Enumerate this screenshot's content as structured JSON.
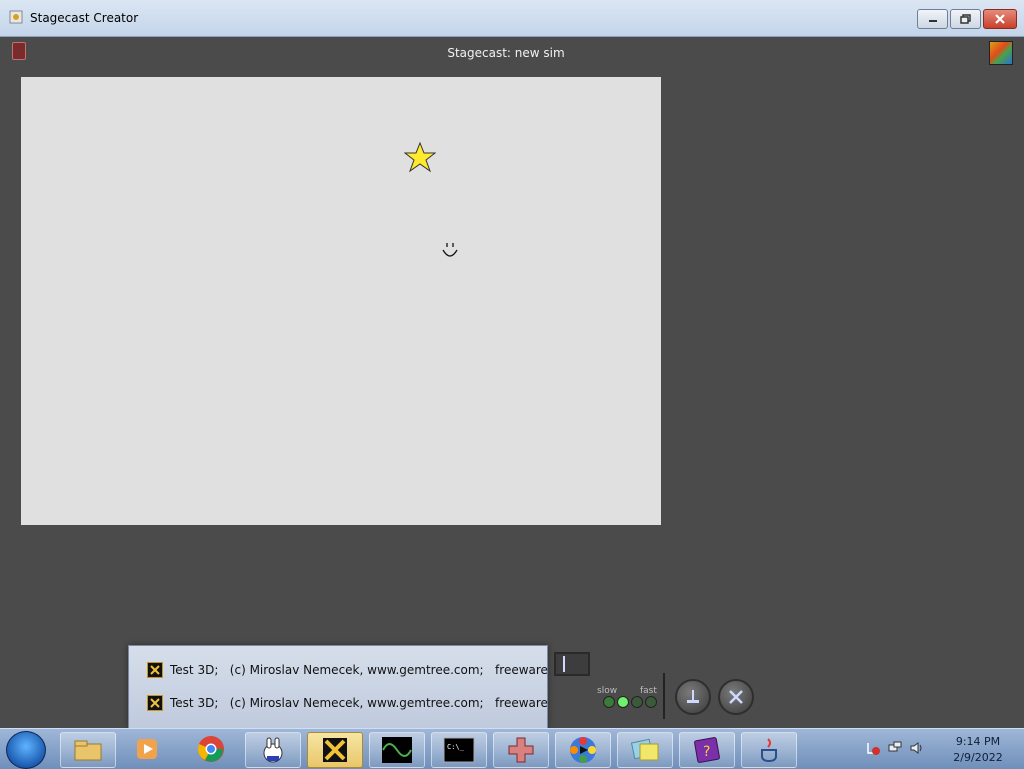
{
  "window": {
    "title": "Stagecast Creator",
    "minimize_glyph": "–",
    "maximize_glyph": "❐",
    "close_glyph": "✕"
  },
  "stagecast": {
    "title": "Stagecast: new sim",
    "book_icon": "rule-book-icon",
    "palette_icon": "color-palette-icon",
    "stage_background": "#e0e0e0",
    "speed_slow": "slow",
    "speed_fast": "fast",
    "speed_level": 2,
    "speed_levels_total": 4
  },
  "popup": {
    "items": [
      {
        "label": "Test 3D;   (c) Miroslav Nemecek, www.gemtree.com;   freeware"
      },
      {
        "label": "Test 3D;   (c) Miroslav Nemecek, www.gemtree.com;   freeware"
      }
    ]
  },
  "taskbar": {
    "items": [
      "start-icon",
      "explorer-icon",
      "media-player-icon",
      "chrome-icon",
      "rabbit-app-icon",
      "peter-x-icon",
      "oscilloscope-icon",
      "cmd-icon",
      "cross-puzzle-icon",
      "flower-game-icon",
      "folders-icon",
      "help-book-icon",
      "java-icon"
    ],
    "time": "9:14 PM",
    "date": "2/9/2022"
  }
}
